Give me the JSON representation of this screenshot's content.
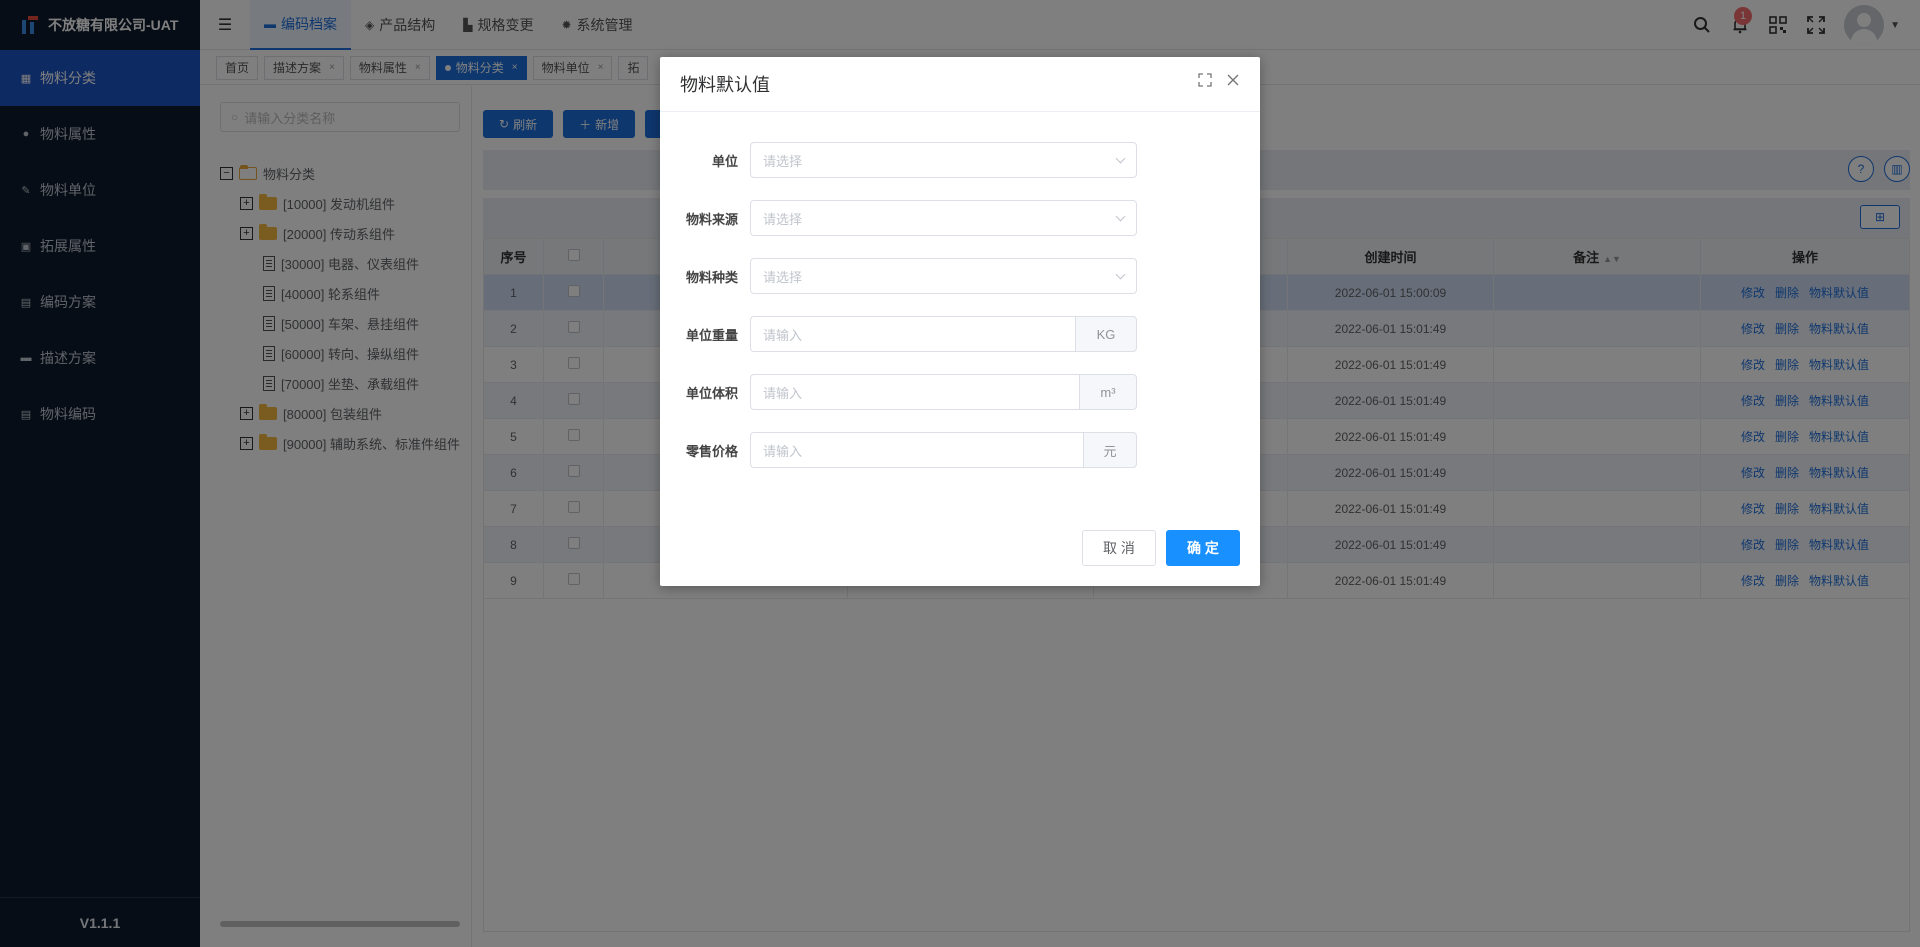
{
  "app": {
    "title": "不放糖有限公司-UAT",
    "version": "V1.1.1"
  },
  "sidebar": {
    "items": [
      {
        "label": "物料分类",
        "icon": "grid-icon",
        "glyph": "▦",
        "active": true
      },
      {
        "label": "物料属性",
        "icon": "info-icon",
        "glyph": "●",
        "active": false
      },
      {
        "label": "物料单位",
        "icon": "ruler-icon",
        "glyph": "✎",
        "active": false
      },
      {
        "label": "拓展属性",
        "icon": "image-icon",
        "glyph": "▣",
        "active": false
      },
      {
        "label": "编码方案",
        "icon": "file-icon",
        "glyph": "▤",
        "active": false
      },
      {
        "label": "描述方案",
        "icon": "monitor-icon",
        "glyph": "▬",
        "active": false
      },
      {
        "label": "物料编码",
        "icon": "doc-icon",
        "glyph": "▤",
        "active": false
      }
    ]
  },
  "header": {
    "tabs": [
      {
        "label": "编码档案",
        "icon": "folder-icon",
        "glyph": "▬",
        "active": true
      },
      {
        "label": "产品结构",
        "icon": "layers-icon",
        "glyph": "◈",
        "active": false
      },
      {
        "label": "规格变更",
        "icon": "chart-icon",
        "glyph": "▙",
        "active": false
      },
      {
        "label": "系统管理",
        "icon": "gear-icon",
        "glyph": "✹",
        "active": false
      }
    ],
    "notification_count": "1"
  },
  "tags": [
    {
      "label": "首页",
      "closable": false,
      "active": false
    },
    {
      "label": "描述方案",
      "closable": true,
      "active": false
    },
    {
      "label": "物料属性",
      "closable": true,
      "active": false
    },
    {
      "label": "物料分类",
      "closable": true,
      "active": true
    },
    {
      "label": "物料单位",
      "closable": true,
      "active": false
    },
    {
      "label": "拓",
      "closable": false,
      "active": false
    }
  ],
  "tree": {
    "search_placeholder": "请输入分类名称",
    "root": "物料分类",
    "nodes": [
      {
        "label": "[10000] 发动机组件",
        "type": "folder",
        "expandable": true
      },
      {
        "label": "[20000] 传动系组件",
        "type": "folder",
        "expandable": true
      },
      {
        "label": "[30000] 电器、仪表组件",
        "type": "doc",
        "expandable": false
      },
      {
        "label": "[40000] 轮系组件",
        "type": "doc",
        "expandable": false
      },
      {
        "label": "[50000] 车架、悬挂组件",
        "type": "doc",
        "expandable": false
      },
      {
        "label": "[60000] 转向、操纵组件",
        "type": "doc",
        "expandable": false
      },
      {
        "label": "[70000] 坐垫、承载组件",
        "type": "doc",
        "expandable": false
      },
      {
        "label": "[80000] 包装组件",
        "type": "folder",
        "expandable": true
      },
      {
        "label": "[90000] 辅助系统、标准件组件",
        "type": "folder",
        "expandable": true
      }
    ]
  },
  "toolbar": {
    "refresh_label": "刷新",
    "add_label": "新增"
  },
  "table": {
    "columns": {
      "index": "序号",
      "created": "创建时间",
      "remark": "备注",
      "actions": "操作"
    },
    "actions": {
      "edit": "修改",
      "delete": "删除",
      "default": "物料默认值"
    },
    "rows": [
      {
        "index": "1",
        "created": "2022-06-01 15:00:09"
      },
      {
        "index": "2",
        "created": "2022-06-01 15:01:49"
      },
      {
        "index": "3",
        "created": "2022-06-01 15:01:49"
      },
      {
        "index": "4",
        "created": "2022-06-01 15:01:49"
      },
      {
        "index": "5",
        "created": "2022-06-01 15:01:49"
      },
      {
        "index": "6",
        "created": "2022-06-01 15:01:49"
      },
      {
        "index": "7",
        "created": "2022-06-01 15:01:49"
      },
      {
        "index": "8",
        "created": "2022-06-01 15:01:49"
      },
      {
        "index": "9",
        "created": "2022-06-01 15:01:49"
      }
    ]
  },
  "modal": {
    "title": "物料默认值",
    "fields": {
      "unit": {
        "label": "单位",
        "placeholder": "请选择"
      },
      "source": {
        "label": "物料来源",
        "placeholder": "请选择"
      },
      "kind": {
        "label": "物料种类",
        "placeholder": "请选择"
      },
      "weight": {
        "label": "单位重量",
        "placeholder": "请输入",
        "suffix": "KG"
      },
      "volume": {
        "label": "单位体积",
        "placeholder": "请输入",
        "suffix": "m³"
      },
      "price": {
        "label": "零售价格",
        "placeholder": "请输入",
        "suffix": "元"
      }
    },
    "cancel_label": "取 消",
    "ok_label": "确 定"
  }
}
